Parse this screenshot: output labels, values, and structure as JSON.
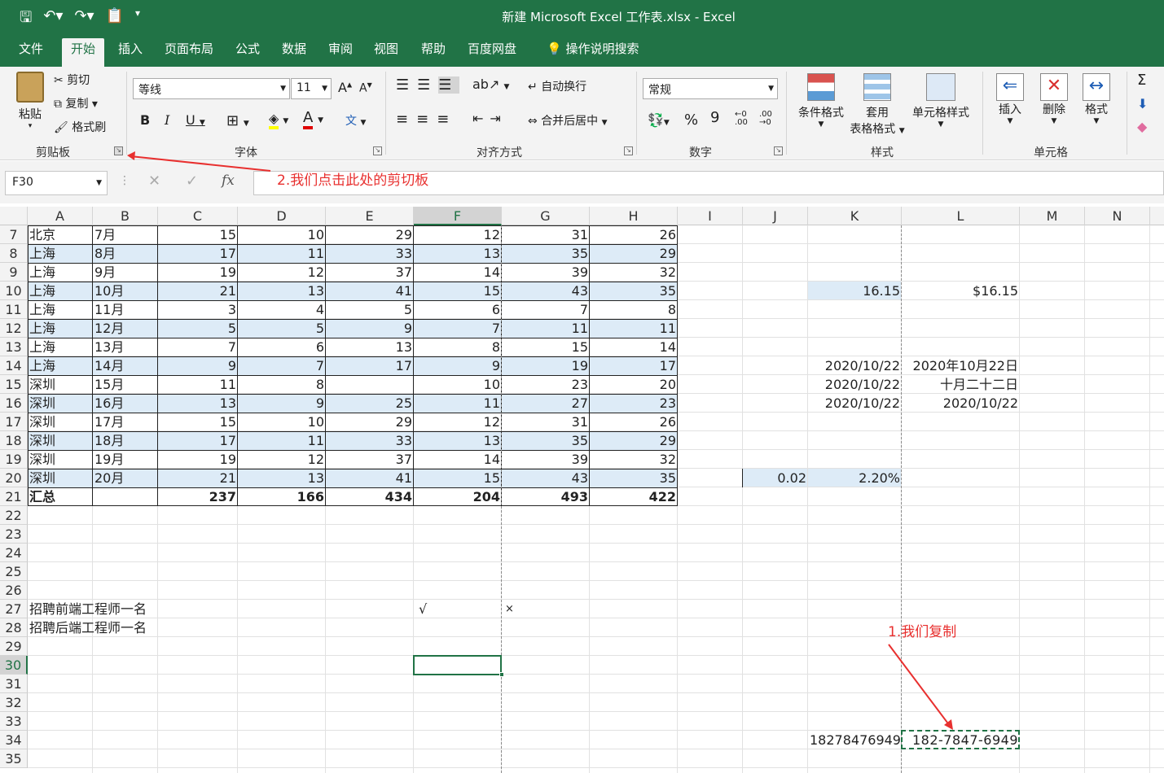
{
  "title": "新建 Microsoft Excel 工作表.xlsx  -  Excel",
  "tabs": [
    "文件",
    "开始",
    "插入",
    "页面布局",
    "公式",
    "数据",
    "审阅",
    "视图",
    "帮助",
    "百度网盘",
    "操作说明搜索"
  ],
  "ribbon": {
    "clipboard": {
      "paste": "粘贴",
      "cut": "剪切",
      "copy": "复制",
      "format_painter": "格式刷",
      "label": "剪贴板"
    },
    "font": {
      "name": "等线",
      "size": "11",
      "label": "字体",
      "bold": "B",
      "italic": "I",
      "underline": "U",
      "grow": "A",
      "shrink": "A",
      "color": "A",
      "wen": "文"
    },
    "align": {
      "wrap": "自动换行",
      "merge": "合并后居中",
      "label": "对齐方式"
    },
    "number": {
      "format": "常规",
      "label": "数字",
      "percent": "%",
      "comma": "9"
    },
    "styles": {
      "conditional": "条件格式",
      "table_line1": "套用",
      "table_line2": "表格格式",
      "cell_styles": "单元格样式",
      "label": "样式"
    },
    "cells": {
      "insert": "插入",
      "delete": "删除",
      "format": "格式",
      "label": "单元格"
    }
  },
  "formula_bar": {
    "name_box": "F30",
    "fx": "fx",
    "value": ""
  },
  "annotations": {
    "step2": "2.我们点击此处的剪切板",
    "step1": "1.我们复制"
  },
  "columns": [
    "A",
    "B",
    "C",
    "D",
    "E",
    "F",
    "G",
    "H",
    "I",
    "J",
    "K",
    "L",
    "M",
    "N"
  ],
  "rows": [
    "7",
    "8",
    "9",
    "10",
    "11",
    "12",
    "13",
    "14",
    "15",
    "16",
    "17",
    "18",
    "19",
    "20",
    "21",
    "22",
    "23",
    "24",
    "25",
    "26",
    "27",
    "28",
    "29",
    "30",
    "31",
    "32",
    "33",
    "34",
    "35"
  ],
  "table": [
    [
      "北京",
      "7月",
      "15",
      "10",
      "29",
      "12",
      "31",
      "26"
    ],
    [
      "上海",
      "8月",
      "17",
      "11",
      "33",
      "13",
      "35",
      "29"
    ],
    [
      "上海",
      "9月",
      "19",
      "12",
      "37",
      "14",
      "39",
      "32"
    ],
    [
      "上海",
      "10月",
      "21",
      "13",
      "41",
      "15",
      "43",
      "35"
    ],
    [
      "上海",
      "11月",
      "3",
      "4",
      "5",
      "6",
      "7",
      "8"
    ],
    [
      "上海",
      "12月",
      "5",
      "5",
      "9",
      "7",
      "11",
      "11"
    ],
    [
      "上海",
      "13月",
      "7",
      "6",
      "13",
      "8",
      "15",
      "14"
    ],
    [
      "上海",
      "14月",
      "9",
      "7",
      "17",
      "9",
      "19",
      "17"
    ],
    [
      "深圳",
      "15月",
      "11",
      "8",
      "",
      "10",
      "23",
      "20"
    ],
    [
      "深圳",
      "16月",
      "13",
      "9",
      "25",
      "11",
      "27",
      "23"
    ],
    [
      "深圳",
      "17月",
      "15",
      "10",
      "29",
      "12",
      "31",
      "26"
    ],
    [
      "深圳",
      "18月",
      "17",
      "11",
      "33",
      "13",
      "35",
      "29"
    ],
    [
      "深圳",
      "19月",
      "19",
      "12",
      "37",
      "14",
      "39",
      "32"
    ],
    [
      "深圳",
      "20月",
      "21",
      "13",
      "41",
      "15",
      "43",
      "35"
    ],
    [
      "汇总",
      "",
      "237",
      "166",
      "434",
      "204",
      "493",
      "422"
    ]
  ],
  "extra": {
    "k10": "16.15",
    "l10": "$16.15",
    "k14": "2020/10/22",
    "l14": "2020年10月22日",
    "k15": "2020/10/22",
    "l15": "十月二十二日",
    "k16": "2020/10/22",
    "l16": "2020/10/22",
    "j20": "0.02",
    "k20": "2.20%",
    "a27": "招聘前端工程师一名",
    "f27": "√",
    "g27": "×",
    "a28": "招聘后端工程师一名",
    "k34": "18278476949",
    "l34": "182-7847-6949"
  }
}
